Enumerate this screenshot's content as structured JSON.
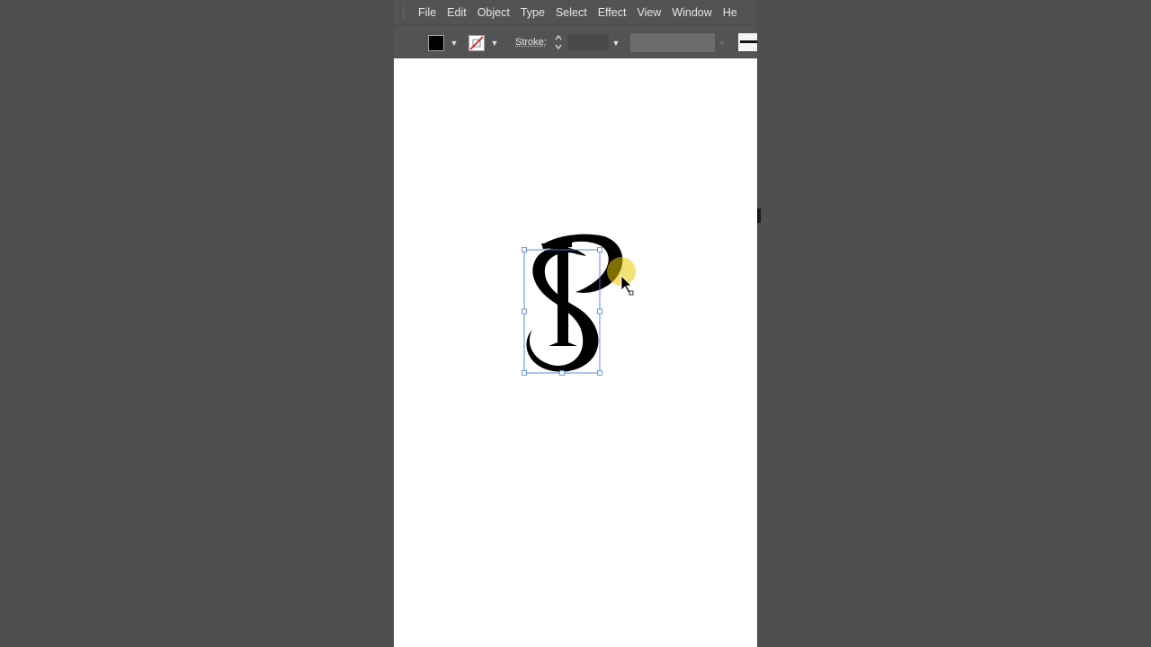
{
  "menu": {
    "items": [
      "File",
      "Edit",
      "Object",
      "Type",
      "Select",
      "Effect",
      "View",
      "Window",
      "He"
    ]
  },
  "control_bar": {
    "fill_color": "#000000",
    "stroke_color": "none",
    "stroke_label": "Stroke:",
    "stroke_weight": "",
    "variable_width_profile": ""
  },
  "artwork": {
    "description_letters": [
      "P",
      "S"
    ],
    "fill_color": "#000000",
    "selection_color": "#4a7fd6",
    "cursor_highlight_color": "#e8c800"
  },
  "colors": {
    "ui_background": "#535353",
    "outer_background": "#4f4f4f",
    "artboard": "#ffffff",
    "menu_text": "#e6e6e6"
  }
}
